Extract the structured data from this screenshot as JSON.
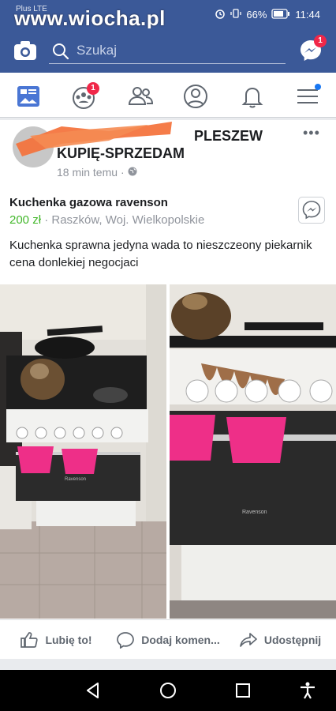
{
  "status": {
    "carrier": "Plus LTE",
    "battery": "66%",
    "time": "11:44"
  },
  "watermark": "www.wiocha.pl",
  "topbar": {
    "search_placeholder": "Szukaj",
    "messenger_badge": "1"
  },
  "nav": {
    "friends_badge": "1"
  },
  "post": {
    "group_name_part1": "PLESZEW",
    "group_name_part2": "KUPIĘ-SPRZEDAM",
    "time": "18 min temu",
    "product_name": "Kuchenka gazowa ravenson",
    "price": "200 zł",
    "location": "Raszków, Woj. Wielkopolskie",
    "description": "Kuchenka sprawna jedyna wada to nieszczeony piekarnik  cena donlekiej negocjaci",
    "oven_brand": "Ravenson"
  },
  "actions": {
    "like": "Lubię to!",
    "comment": "Dodaj komen...",
    "share": "Udostępnij"
  },
  "colors": {
    "facebook_blue": "#3b5998",
    "badge_red": "#f02849",
    "price_green": "#42b72a",
    "scribble_orange": "#f4713a"
  }
}
